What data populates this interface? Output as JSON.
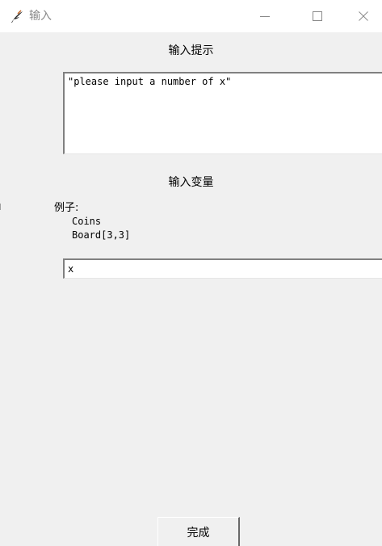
{
  "window": {
    "title": "输入",
    "icon": "feather-icon",
    "controls": {
      "minimize": "minimize-icon",
      "maximize": "maximize-icon",
      "close": "close-icon"
    }
  },
  "prompt": {
    "label": "输入提示",
    "text": "\"please input a number of x\""
  },
  "variable": {
    "label": "输入变量",
    "example_heading": "例子:",
    "example_lines": [
      "Coins",
      "Board[3,3]"
    ],
    "input_value": "x"
  },
  "actions": {
    "done_label": "完成"
  }
}
